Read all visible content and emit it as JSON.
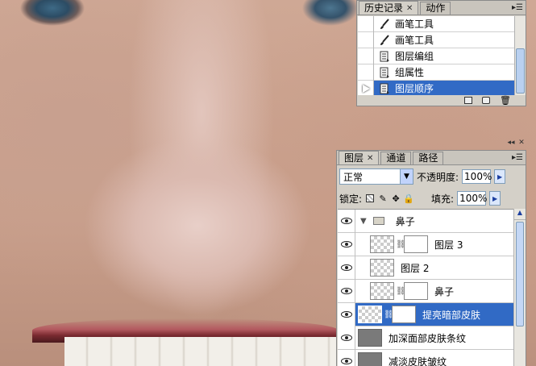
{
  "history_panel": {
    "tabs": [
      {
        "label": "历史记录",
        "active": true
      },
      {
        "label": "动作",
        "active": false
      }
    ],
    "items": [
      {
        "label": "画笔工具",
        "icon": "brush-icon",
        "selected": false
      },
      {
        "label": "画笔工具",
        "icon": "brush-icon",
        "selected": false
      },
      {
        "label": "图层编组",
        "icon": "history-state-icon",
        "selected": false
      },
      {
        "label": "组属性",
        "icon": "history-state-icon",
        "selected": false
      },
      {
        "label": "图层顺序",
        "icon": "history-state-icon",
        "selected": true
      }
    ],
    "footer_icons": [
      "new-document-from-state-icon",
      "snapshot-icon",
      "trash-icon"
    ]
  },
  "layers_panel": {
    "tabs": [
      {
        "label": "图层",
        "active": true
      },
      {
        "label": "通道",
        "active": false
      },
      {
        "label": "路径",
        "active": false
      }
    ],
    "blend_mode": "正常",
    "opacity_label": "不透明度:",
    "opacity_value": "100%",
    "lock_label": "锁定:",
    "fill_label": "填充:",
    "fill_value": "100%",
    "layers": [
      {
        "name": "鼻子",
        "type": "group",
        "expanded": true
      },
      {
        "name": "图层 3",
        "type": "pixel-mask",
        "indent": true
      },
      {
        "name": "图层 2",
        "type": "pixel",
        "indent": true
      },
      {
        "name": "鼻子",
        "type": "pixel-mask",
        "indent": true
      },
      {
        "name": "提亮暗部皮肤",
        "type": "pixel-mask",
        "selected": true
      },
      {
        "name": "加深面部皮肤条纹",
        "type": "gray"
      },
      {
        "name": "减淡皮肤皱纹",
        "type": "gray"
      }
    ]
  },
  "colors": {
    "selection": "#316ac5",
    "panel_bg": "#d4d0c8",
    "skin": "#cfa895"
  }
}
